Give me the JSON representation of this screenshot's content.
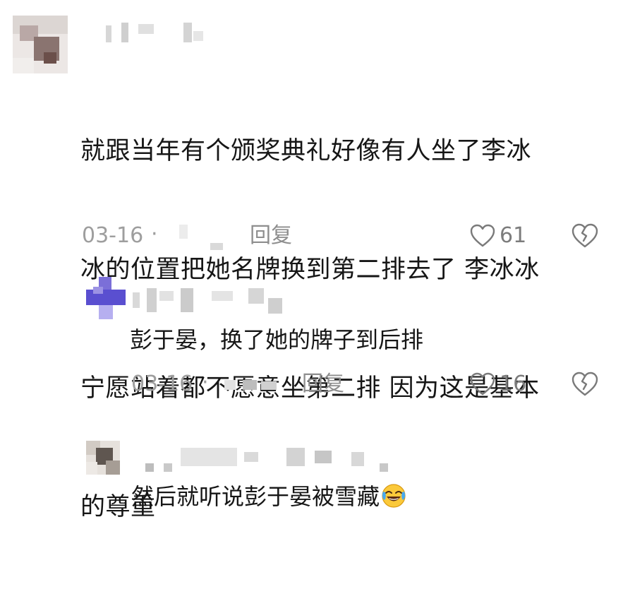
{
  "comments": [
    {
      "text": "就跟当年有个颁奖典礼好像有人坐了李冰冰的位置把她名牌换到第二排去了 李冰冰宁愿站着都不愿意坐第二排 因为这是基本的尊重",
      "lines": [
        "就跟当年有个颁奖典礼好像有人坐了李冰",
        "冰的位置把她名牌换到第二排去了 李冰冰",
        "宁愿站着都不愿意坐第二排 因为这是基本",
        "的尊重"
      ],
      "date": "03-16",
      "separator": "·",
      "reply_label": "回复",
      "likes": "61",
      "icons": {
        "like": "heart-outline-icon",
        "dislike": "broken-heart-icon"
      }
    },
    {
      "text": "彭于晏，换了她的牌子到后排",
      "date": "03-16",
      "separator": "·",
      "reply_label": "回复",
      "likes": "16",
      "icons": {
        "like": "heart-outline-icon",
        "dislike": "broken-heart-icon"
      }
    },
    {
      "text": "然后就听说彭于晏被雪藏",
      "emoji": "laughing-crying-emoji"
    }
  ],
  "colors": {
    "text": "#161616",
    "meta": "#9e9e9e",
    "reply_avatar_accent": "#5a4fd0"
  }
}
